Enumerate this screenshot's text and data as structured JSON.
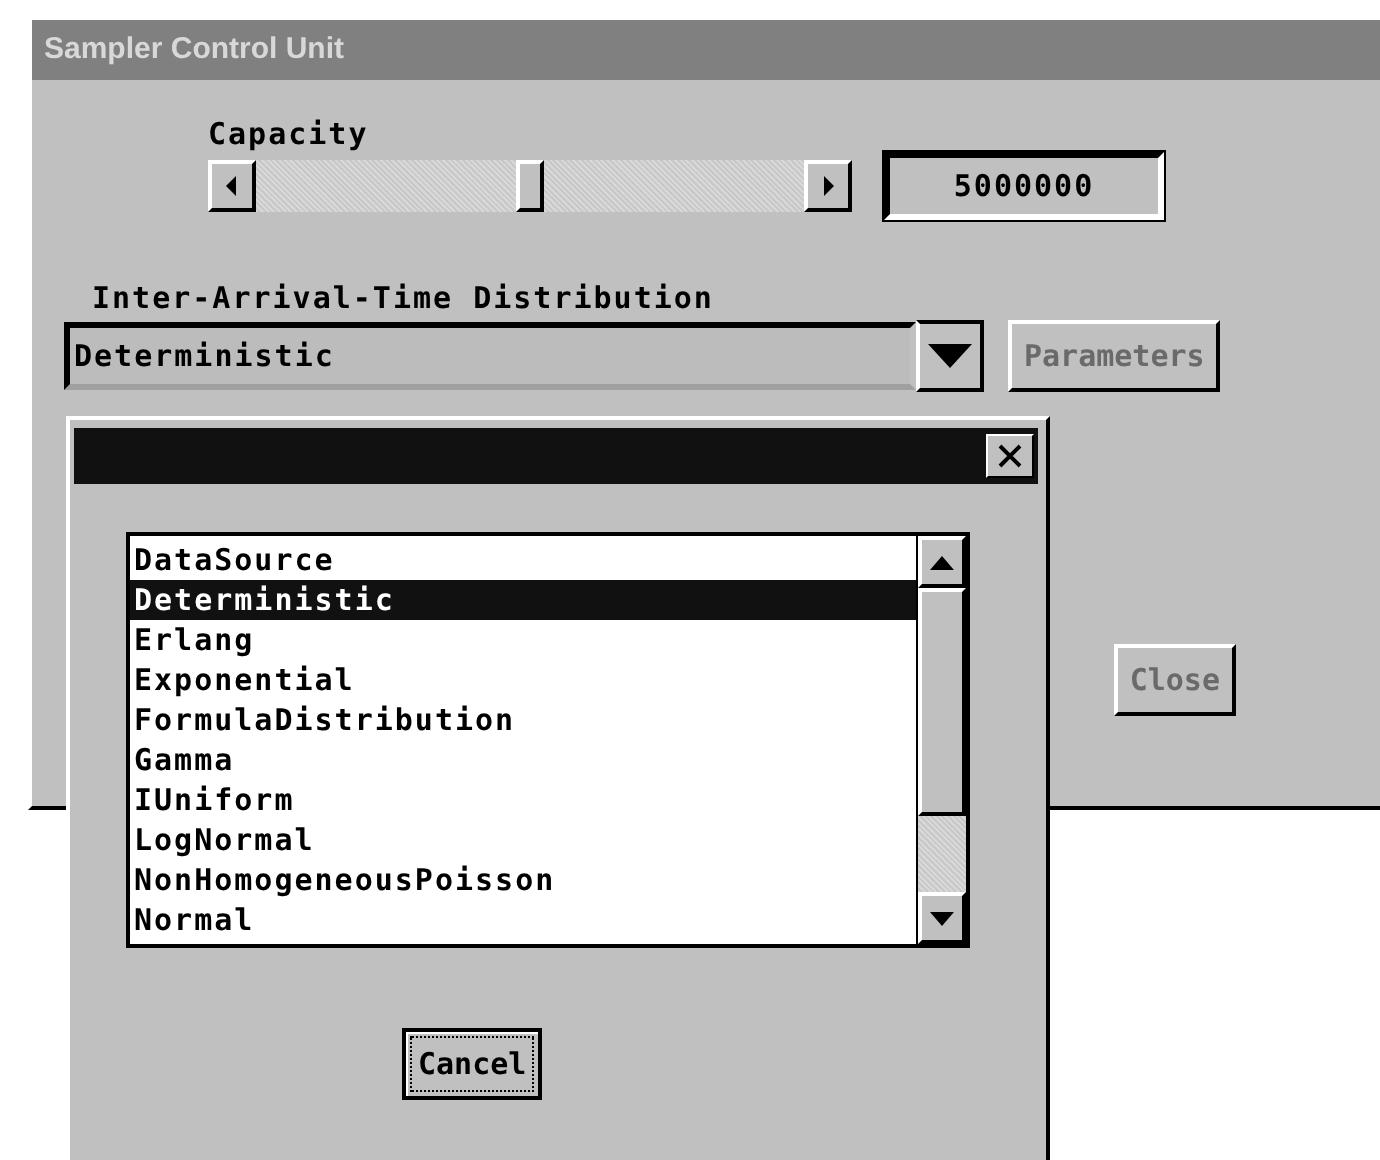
{
  "window": {
    "title": "Sampler Control Unit"
  },
  "capacity": {
    "label": "Capacity",
    "level": 0.5,
    "value": "5000000"
  },
  "distribution": {
    "label": "Inter-Arrival-Time Distribution",
    "value": "Deterministic"
  },
  "parameters_button": {
    "label": "Parameters",
    "disabled": true
  },
  "close_button": {
    "label": "Close",
    "disabled": true
  },
  "dialog": {
    "items": [
      {
        "label": "DataSource",
        "selected": false
      },
      {
        "label": "Deterministic",
        "selected": true
      },
      {
        "label": "Erlang",
        "selected": false
      },
      {
        "label": "Exponential",
        "selected": false
      },
      {
        "label": "FormulaDistribution",
        "selected": false
      },
      {
        "label": "Gamma",
        "selected": false
      },
      {
        "label": "IUniform",
        "selected": false
      },
      {
        "label": "LogNormal",
        "selected": false
      },
      {
        "label": "NonHomogeneousPoisson",
        "selected": false
      },
      {
        "label": "Normal",
        "selected": false
      }
    ],
    "cancel_button": {
      "label": "Cancel",
      "focused": true
    }
  }
}
